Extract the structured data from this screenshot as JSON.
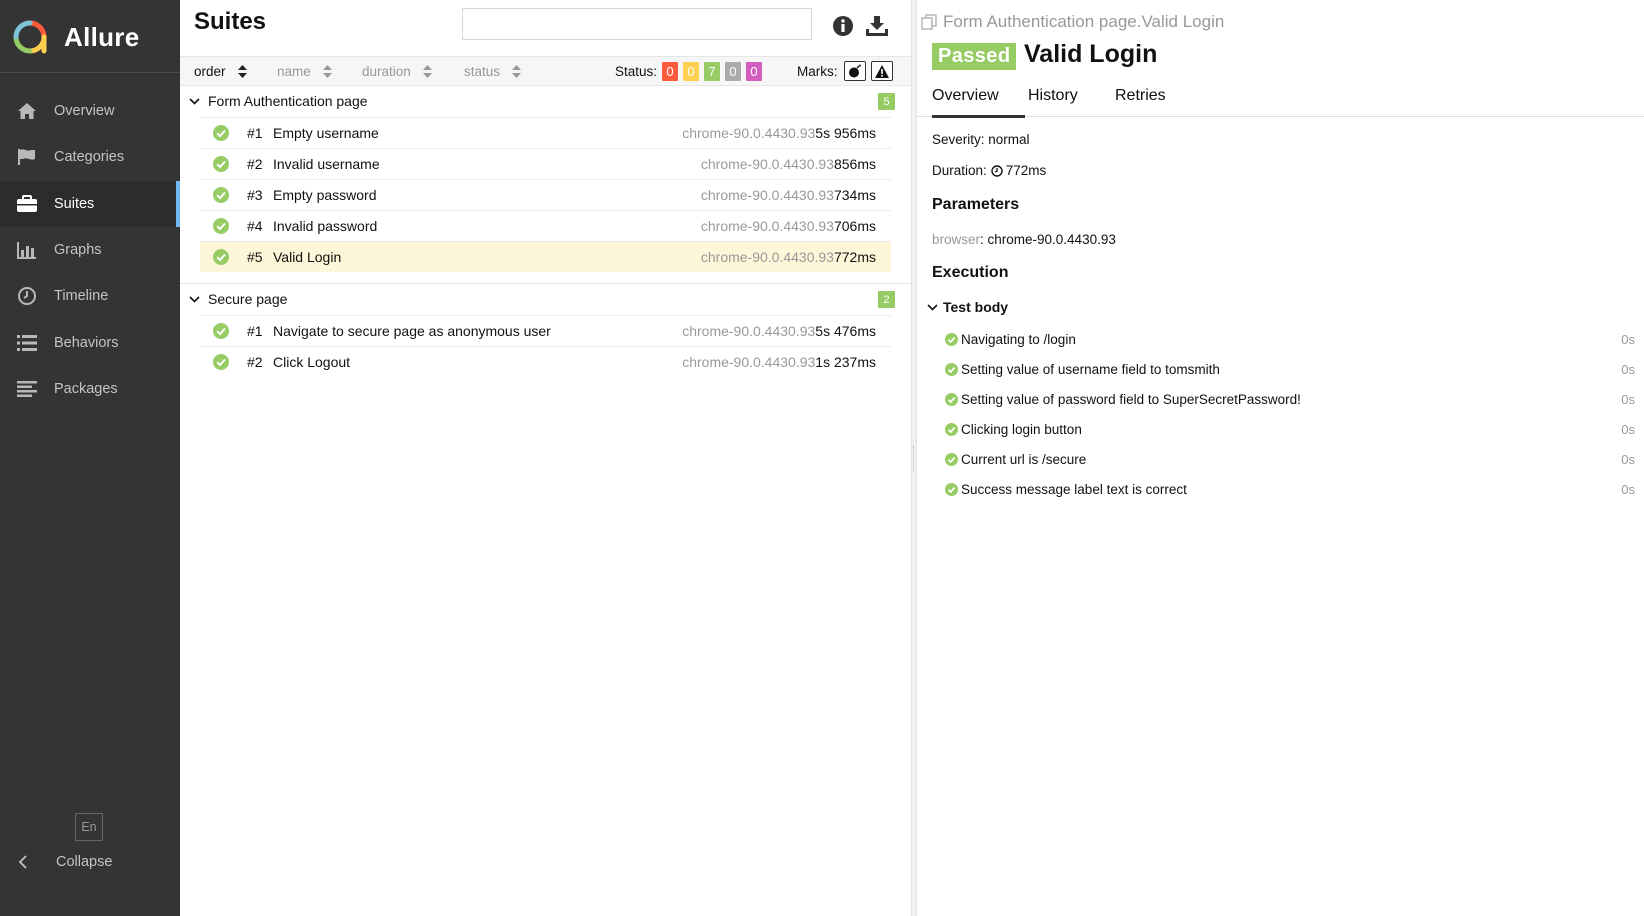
{
  "app": {
    "name": "Allure"
  },
  "sidebar": {
    "items": [
      {
        "label": "Overview",
        "icon": "home-icon"
      },
      {
        "label": "Categories",
        "icon": "flag-icon"
      },
      {
        "label": "Suites",
        "icon": "briefcase-icon",
        "active": true
      },
      {
        "label": "Graphs",
        "icon": "bar-chart-icon"
      },
      {
        "label": "Timeline",
        "icon": "clock-icon"
      },
      {
        "label": "Behaviors",
        "icon": "list-icon"
      },
      {
        "label": "Packages",
        "icon": "align-left-icon"
      }
    ],
    "language": "En",
    "collapse_label": "Collapse"
  },
  "suites": {
    "title": "Suites",
    "search": {
      "value": "",
      "placeholder": ""
    },
    "sort": [
      {
        "label": "order",
        "active": true
      },
      {
        "label": "name"
      },
      {
        "label": "duration"
      },
      {
        "label": "status"
      }
    ],
    "status_label": "Status:",
    "status_counts": [
      {
        "name": "failed",
        "value": "0",
        "color": "#fd5a3e"
      },
      {
        "name": "broken",
        "value": "0",
        "color": "#ffd050"
      },
      {
        "name": "passed",
        "value": "7",
        "color": "#97cc64"
      },
      {
        "name": "skipped",
        "value": "0",
        "color": "#aaaaaa"
      },
      {
        "name": "unknown",
        "value": "0",
        "color": "#d35ebe"
      }
    ],
    "marks_label": "Marks:",
    "groups": [
      {
        "name": "Form Authentication page",
        "count": "5",
        "tests": [
          {
            "num": "#1",
            "name": "Empty username",
            "env": "chrome-90.0.4430.93",
            "duration": "5s 956ms"
          },
          {
            "num": "#2",
            "name": "Invalid username",
            "env": "chrome-90.0.4430.93",
            "duration": "856ms"
          },
          {
            "num": "#3",
            "name": "Empty password",
            "env": "chrome-90.0.4430.93",
            "duration": "734ms"
          },
          {
            "num": "#4",
            "name": "Invalid password",
            "env": "chrome-90.0.4430.93",
            "duration": "706ms"
          },
          {
            "num": "#5",
            "name": "Valid Login",
            "env": "chrome-90.0.4430.93",
            "duration": "772ms",
            "selected": true
          }
        ]
      },
      {
        "name": "Secure page",
        "count": "2",
        "tests": [
          {
            "num": "#1",
            "name": "Navigate to secure page as anonymous user",
            "env": "chrome-90.0.4430.93",
            "duration": "5s 476ms"
          },
          {
            "num": "#2",
            "name": "Click Logout",
            "env": "chrome-90.0.4430.93",
            "duration": "1s 237ms"
          }
        ]
      }
    ]
  },
  "detail": {
    "breadcrumb": "Form Authentication page.Valid Login",
    "status_badge": "Passed",
    "title": "Valid Login",
    "tabs": [
      "Overview",
      "History",
      "Retries"
    ],
    "severity": "Severity: normal",
    "duration_label": "Duration:",
    "duration_value": "772ms",
    "parameters_title": "Parameters",
    "param_key": "browser",
    "param_value": ": chrome-90.0.4430.93",
    "execution_title": "Execution",
    "test_body_label": "Test body",
    "steps": [
      {
        "label": "Navigating to /login",
        "time": "0s"
      },
      {
        "label": "Setting value of username field to tomsmith",
        "time": "0s"
      },
      {
        "label": "Setting value of password field to SuperSecretPassword!",
        "time": "0s"
      },
      {
        "label": "Clicking login button",
        "time": "0s"
      },
      {
        "label": "Current url is /secure",
        "time": "0s"
      },
      {
        "label": "Success message label text is correct",
        "time": "0s"
      }
    ]
  }
}
